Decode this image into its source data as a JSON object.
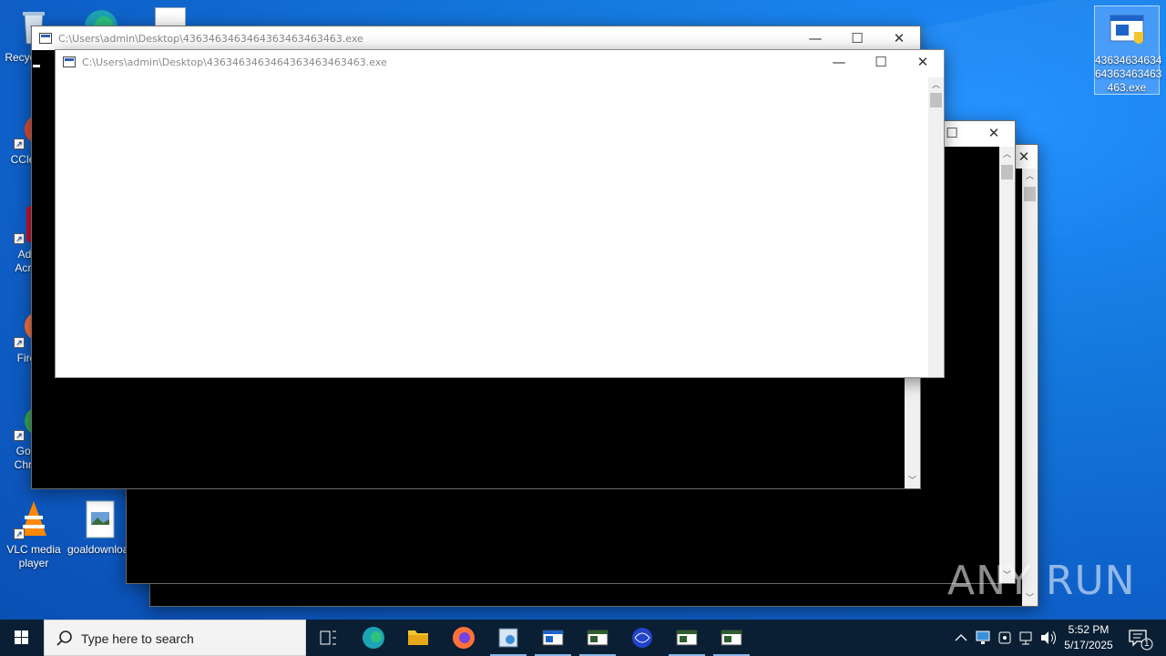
{
  "desktop": {
    "icons": [
      {
        "label": "Recycle Bin"
      },
      {
        "label": "CCleaner"
      },
      {
        "label": "Adobe Acrobat"
      },
      {
        "label": "Firefox"
      },
      {
        "label": "Google Chrome"
      },
      {
        "label": "VLC media player"
      },
      {
        "label": "goaldownload"
      },
      {
        "label": "43634634634 64363463463 463.exe"
      }
    ]
  },
  "windows": {
    "title": "C:\\Users\\admin\\Desktop\\4363463463464363463463463.exe",
    "minimize_glyph": "—",
    "maximize_glyph": "☐",
    "close_glyph": "✕",
    "scroll_up_glyph": "︿",
    "scroll_down_glyph": "﹀"
  },
  "watermark": "ANY RUN",
  "taskbar": {
    "search_placeholder": "Type here to search",
    "time": "5:52 PM",
    "date": "5/17/2025",
    "notification_count": "1",
    "colors": {
      "taskbar_bg": "#0a1f33",
      "accent": "#8ab8ea"
    }
  }
}
